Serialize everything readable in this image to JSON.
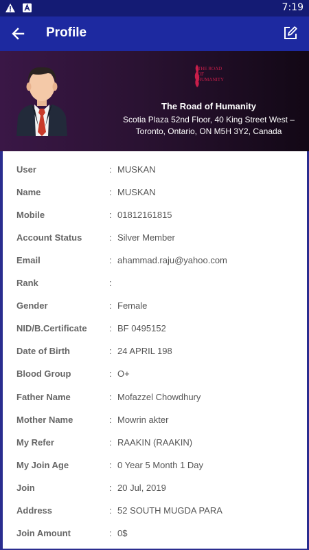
{
  "status_bar": {
    "time": "7:19",
    "icons": [
      "warning-icon",
      "notification-a-icon"
    ]
  },
  "app_bar": {
    "title": "Profile",
    "icons": [
      "back-arrow-icon",
      "edit-icon"
    ]
  },
  "header": {
    "logo_text": "THE ROAD OF HUMANITY",
    "org_name": "The Road of Humanity",
    "address_line1": "Scotia Plaza 52nd Floor, 40 King Street West –",
    "address_line2": "Toronto, Ontario, ON M5H 3Y2, Canada"
  },
  "details": [
    {
      "label": "User",
      "value": "MUSKAN"
    },
    {
      "label": "Name",
      "value": "MUSKAN"
    },
    {
      "label": "Mobile",
      "value": "01812161815"
    },
    {
      "label": "Account Status",
      "value": "Silver Member"
    },
    {
      "label": "Email",
      "value": "ahammad.raju@yahoo.com"
    },
    {
      "label": "Rank",
      "value": ""
    },
    {
      "label": "Gender",
      "value": "Female"
    },
    {
      "label": "NID/B.Certificate",
      "value": "BF 0495152"
    },
    {
      "label": "Date of Birth",
      "value": "24 APRIL 198"
    },
    {
      "label": "Blood Group",
      "value": "O+"
    },
    {
      "label": "Father Name",
      "value": "Mofazzel Chowdhury"
    },
    {
      "label": "Mother Name",
      "value": "Mowrin akter"
    },
    {
      "label": "My Refer",
      "value": "RAAKIN (RAAKIN)"
    },
    {
      "label": "My Join Age",
      "value": "0 Year 5 Month 1 Day"
    },
    {
      "label": "Join",
      "value": "20 Jul, 2019"
    },
    {
      "label": "Address",
      "value": "52 SOUTH MUGDA PARA"
    },
    {
      "label": "Join Amount",
      "value": "0$"
    }
  ],
  "separator": ":",
  "colors": {
    "status_bar": "#141b74",
    "app_bar": "#1d29a0",
    "logo": "#c81e4a"
  }
}
